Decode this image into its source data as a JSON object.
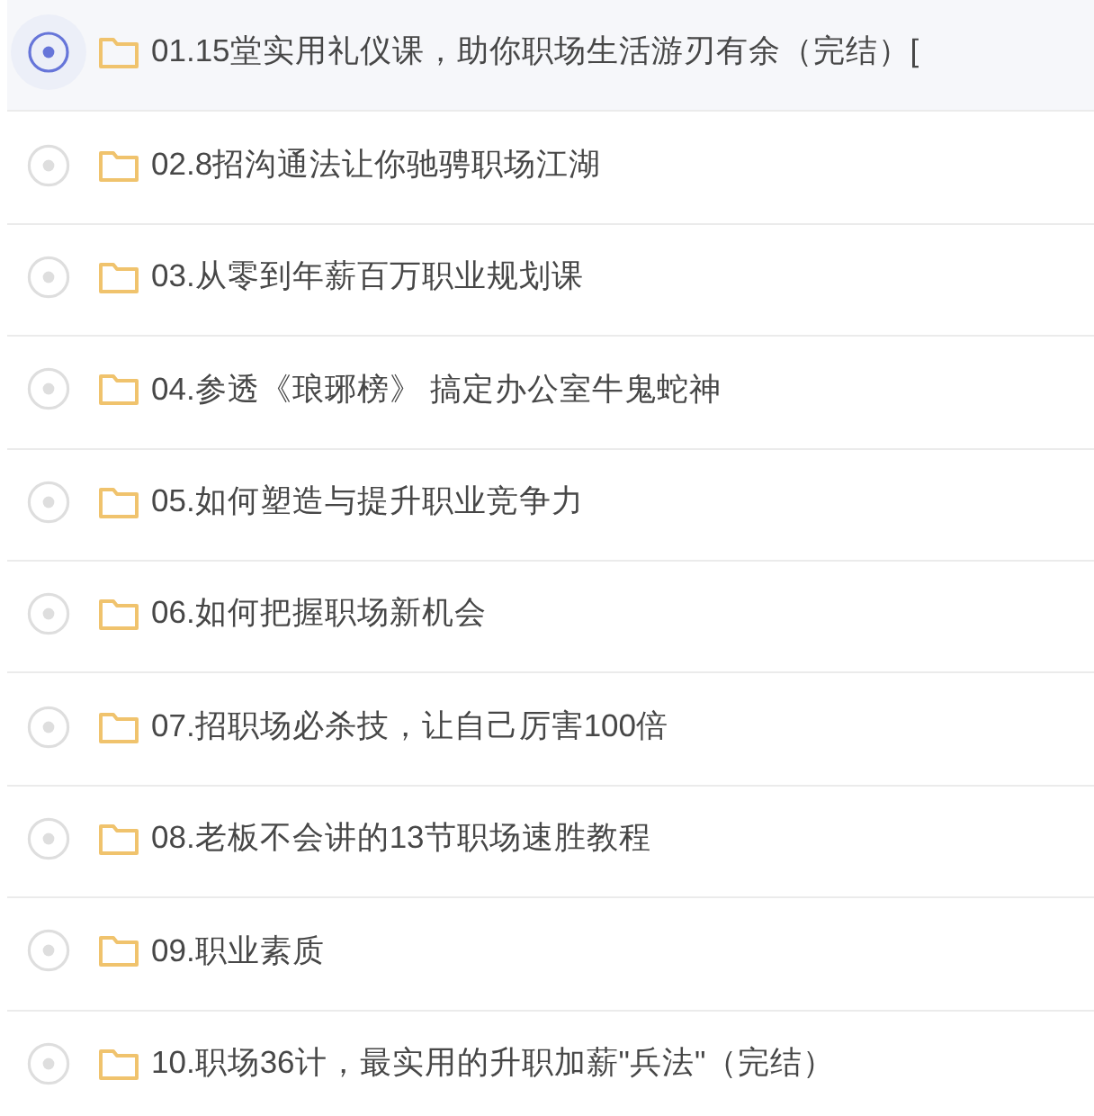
{
  "items": [
    {
      "title": "01.15堂实用礼仪课，助你职场生活游刃有余（完结）[",
      "selected": true
    },
    {
      "title": "02.8招沟通法让你驰骋职场江湖",
      "selected": false
    },
    {
      "title": "03.从零到年薪百万职业规划课",
      "selected": false
    },
    {
      "title": "04.参透《琅琊榜》 搞定办公室牛鬼蛇神",
      "selected": false
    },
    {
      "title": "05.如何塑造与提升职业竞争力",
      "selected": false
    },
    {
      "title": "06.如何把握职场新机会",
      "selected": false
    },
    {
      "title": "07.招职场必杀技，让自己厉害100倍",
      "selected": false
    },
    {
      "title": "08.老板不会讲的13节职场速胜教程",
      "selected": false
    },
    {
      "title": "09.职业素质",
      "selected": false
    },
    {
      "title": "10.职场36计，最实用的升职加薪\"兵法\"（完结）",
      "selected": false
    }
  ]
}
